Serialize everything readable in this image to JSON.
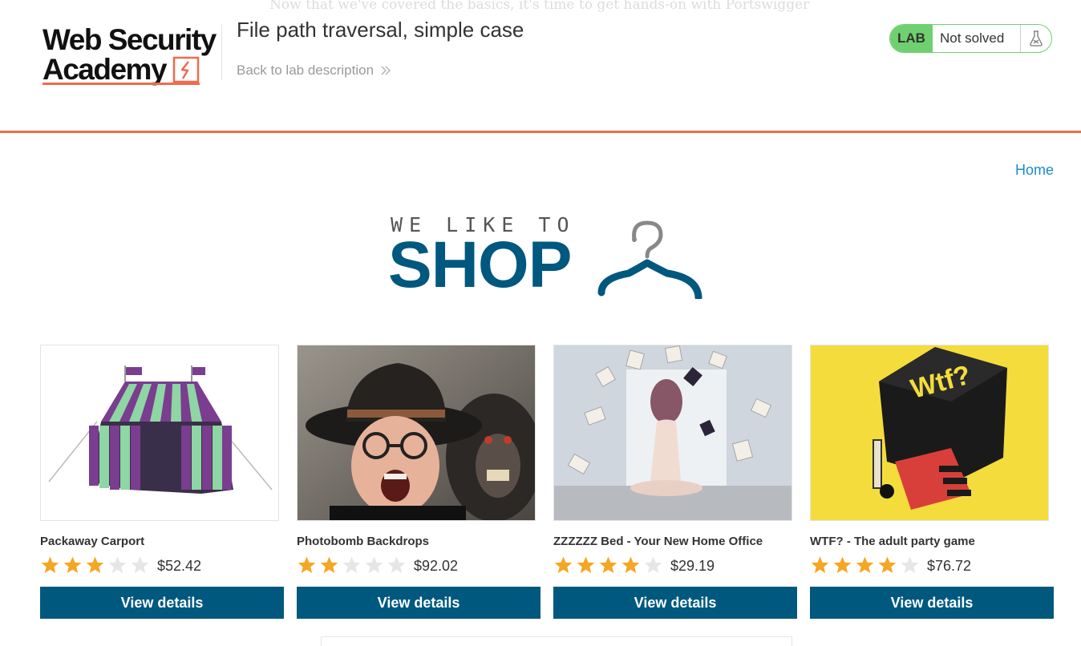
{
  "ghost_text": "Now that we've covered the basics, it's time to get hands-on with Portswigger",
  "header": {
    "logo_line1": "Web Security",
    "logo_line2": "Academy",
    "lab_title": "File path traversal, simple case",
    "back_link": "Back to lab description",
    "status_badge_label": "LAB",
    "status_text": "Not solved",
    "accent_color": "#ee6c4d",
    "status_color": "#6fd06f"
  },
  "nav": {
    "home": "Home"
  },
  "banner": {
    "tagline": "WE LIKE TO",
    "title": "SHOP",
    "brand_color": "#00587e"
  },
  "products": [
    {
      "name": "Packaway Carport",
      "rating": 3,
      "price": "$52.42",
      "button": "View details",
      "image": "striped-tent"
    },
    {
      "name": "Photobomb Backdrops",
      "rating": 2,
      "price": "$92.02",
      "button": "View details",
      "image": "man-with-monkey"
    },
    {
      "name": "ZZZZZZ Bed - Your New Home Office",
      "rating": 4,
      "price": "$29.19",
      "button": "View details",
      "image": "floating-books"
    },
    {
      "name": "WTF? - The adult party game",
      "rating": 4,
      "price": "$76.72",
      "button": "View details",
      "image": "game-box",
      "image_text": "Wtf?"
    }
  ]
}
